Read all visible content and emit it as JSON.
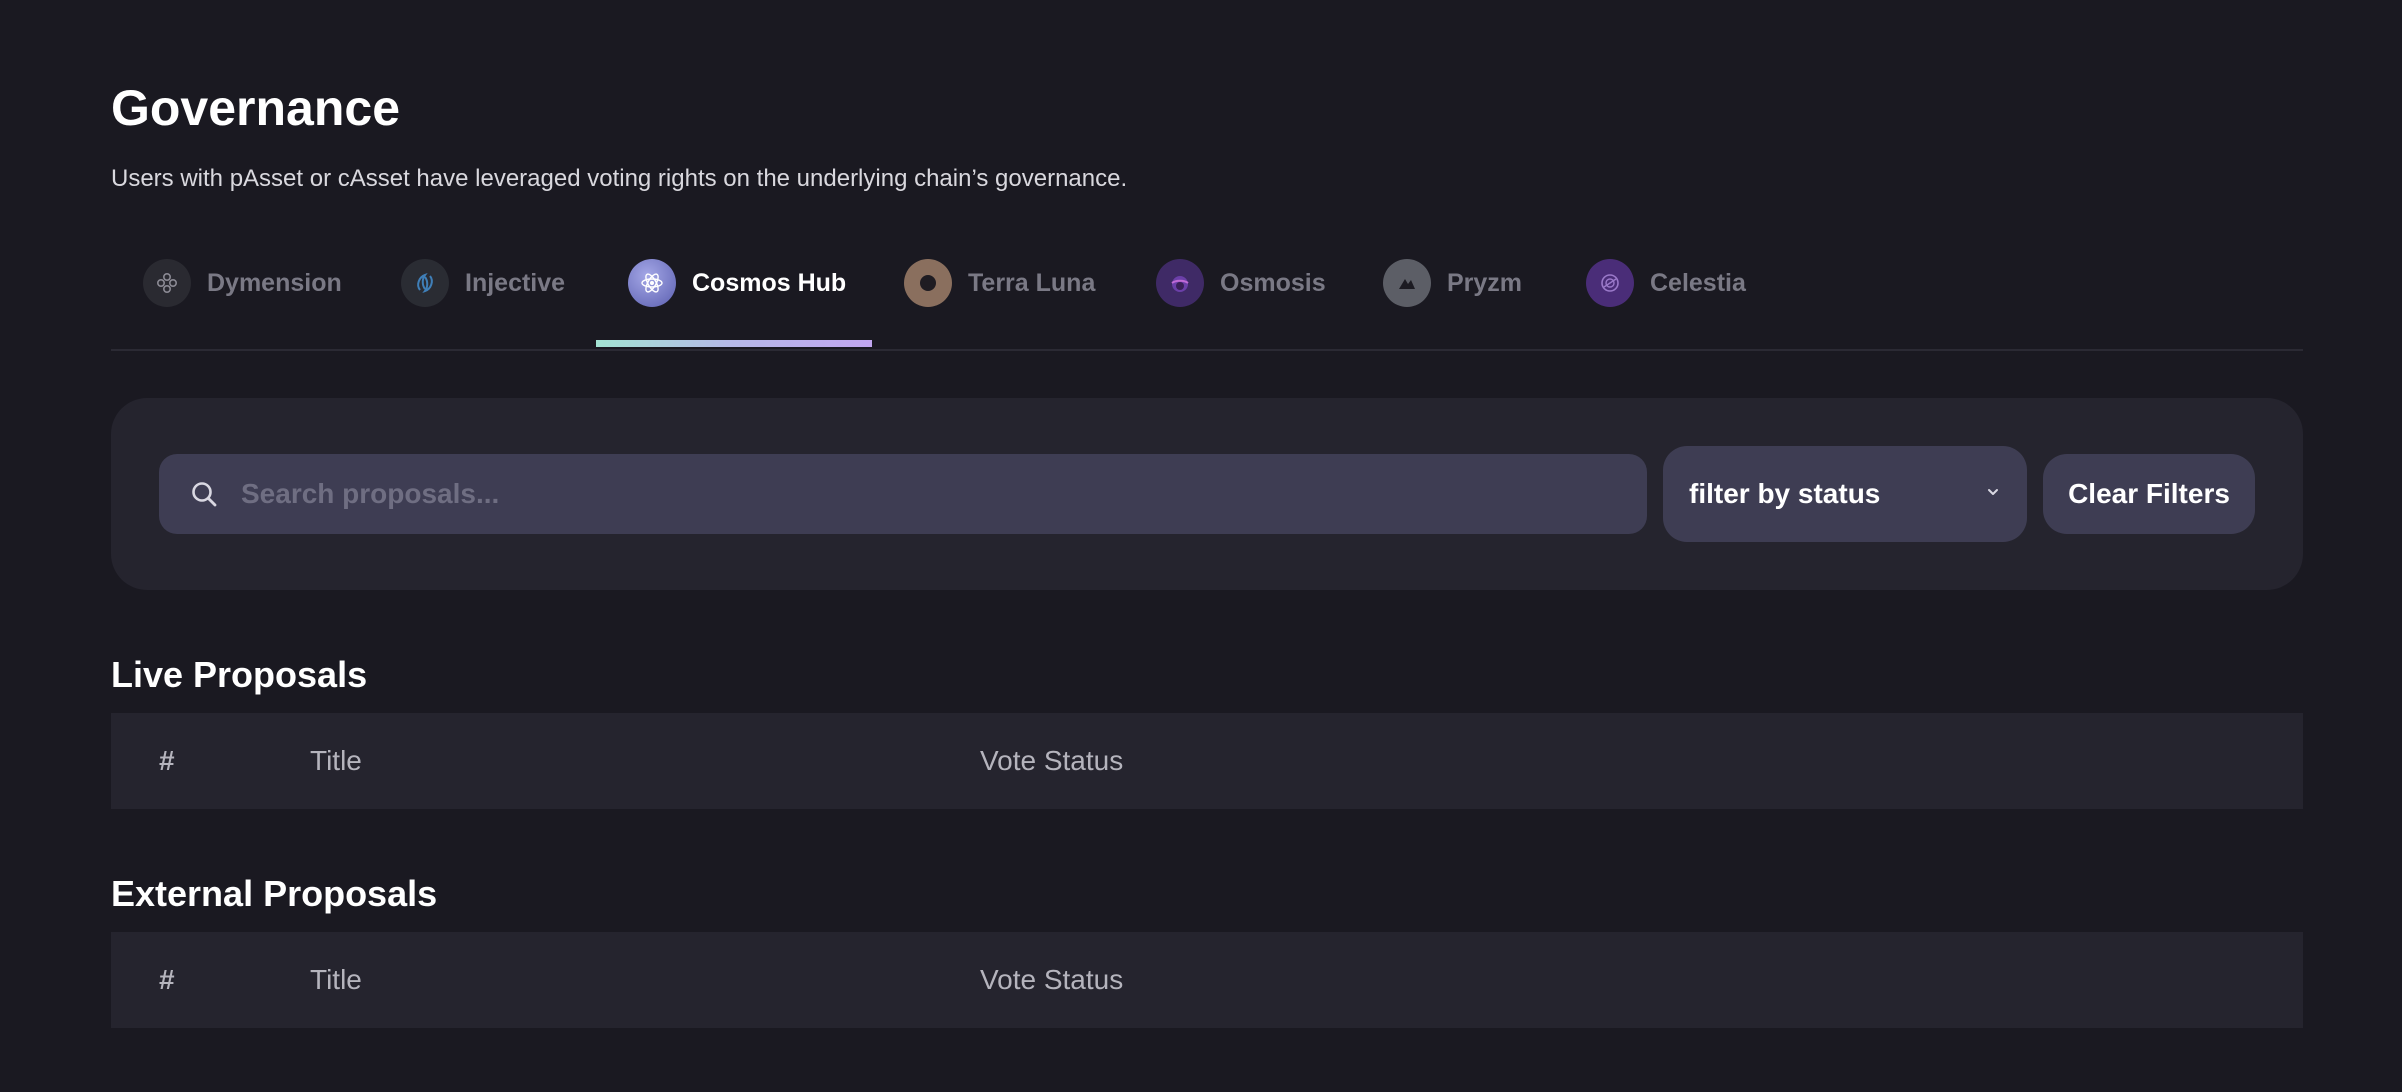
{
  "header": {
    "title": "Governance",
    "subtitle": "Users with pAsset or cAsset have leveraged voting rights on the underlying chain’s governance."
  },
  "tabs": [
    {
      "label": "Dymension",
      "icon": "dymension-icon",
      "active": false
    },
    {
      "label": "Injective",
      "icon": "injective-icon",
      "active": false
    },
    {
      "label": "Cosmos Hub",
      "icon": "cosmos-hub-icon",
      "active": true
    },
    {
      "label": "Terra Luna",
      "icon": "terra-luna-icon",
      "active": false
    },
    {
      "label": "Osmosis",
      "icon": "osmosis-icon",
      "active": false
    },
    {
      "label": "Pryzm",
      "icon": "pryzm-icon",
      "active": false
    },
    {
      "label": "Celestia",
      "icon": "celestia-icon",
      "active": false
    }
  ],
  "filters": {
    "search_placeholder": "Search proposals...",
    "search_value": "",
    "status_select_label": "filter by status",
    "clear_label": "Clear Filters"
  },
  "live_proposals": {
    "title": "Live Proposals",
    "columns": [
      "#",
      "Title",
      "Vote Status"
    ],
    "rows": []
  },
  "external_proposals": {
    "title": "External Proposals",
    "columns": [
      "#",
      "Title",
      "Vote Status"
    ],
    "rows": []
  },
  "colors": {
    "background": "#1a1921",
    "panel": "#25242e",
    "input": "#3e3d53",
    "active_underline_start": "#a3e3d3",
    "active_underline_end": "#c1a6f0"
  }
}
